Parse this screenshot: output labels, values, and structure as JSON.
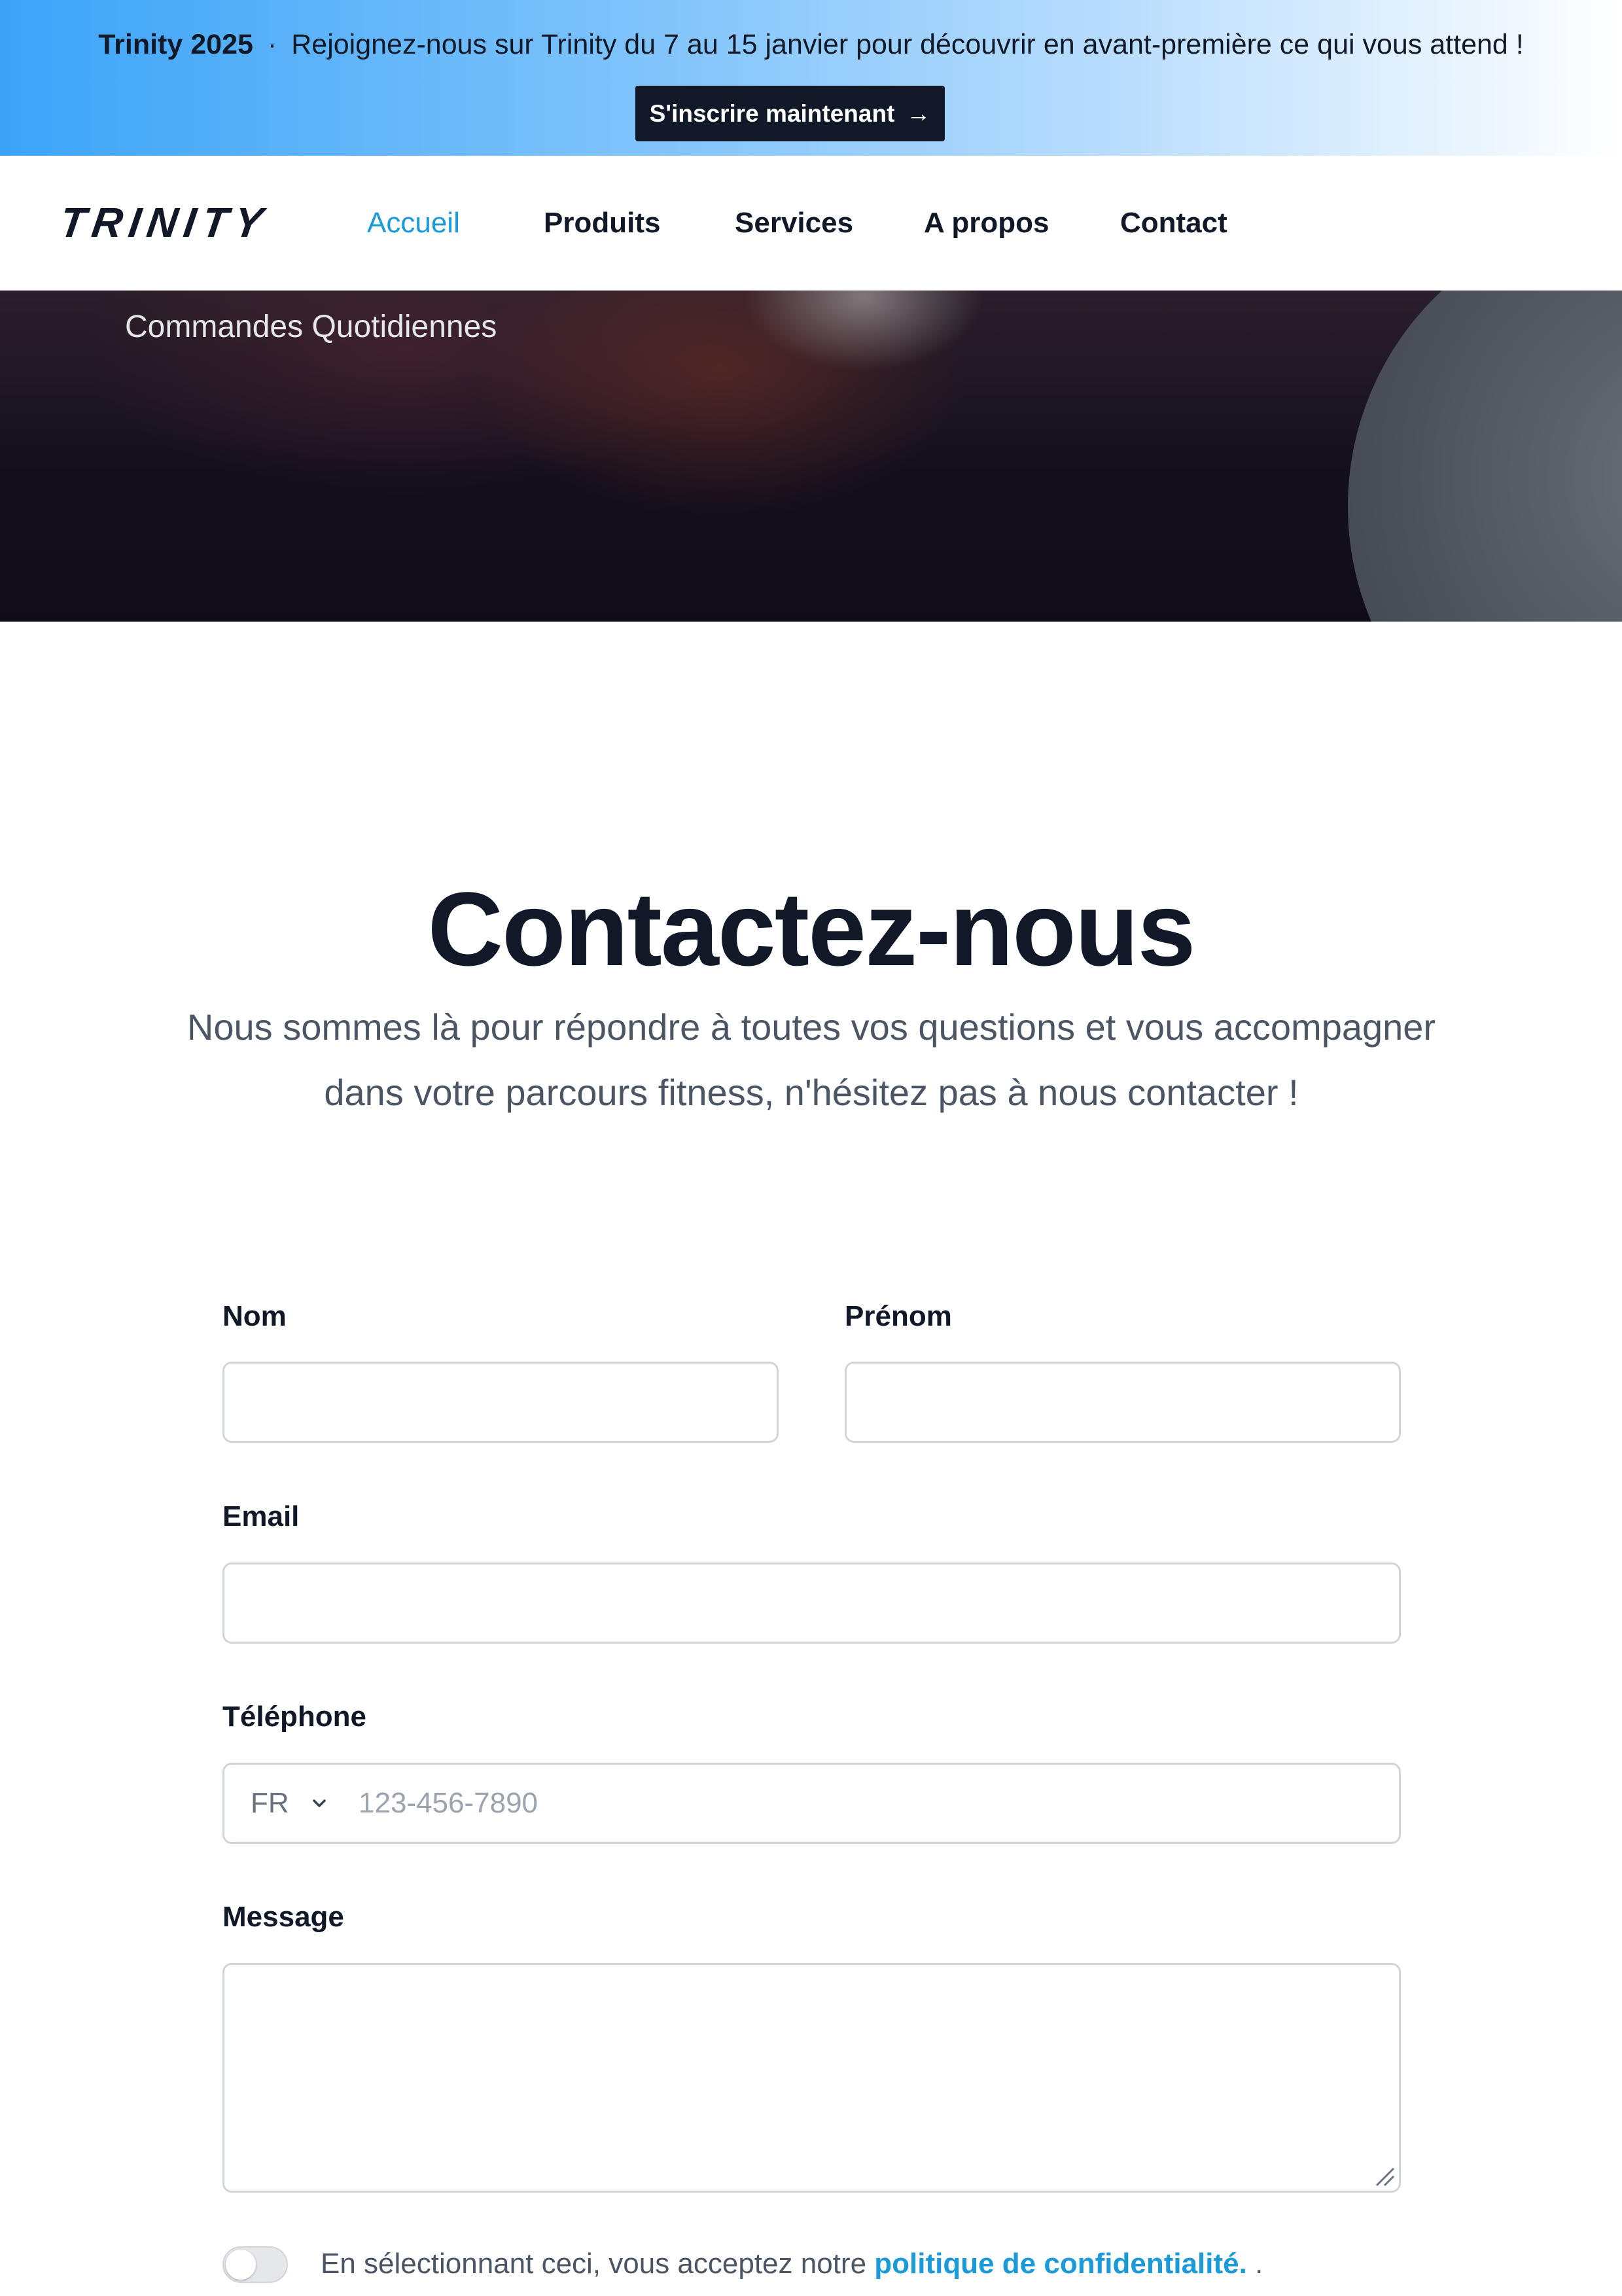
{
  "banner": {
    "brand": "Trinity 2025",
    "separator": "·",
    "message": "Rejoignez-nous sur Trinity du 7 au 15 janvier pour découvrir en avant-première ce qui vous attend !",
    "cta_label": "S'inscrire maintenant",
    "cta_arrow": "→"
  },
  "header": {
    "logo_text": "TRINITY",
    "nav": [
      {
        "label": "Accueil",
        "active": true
      },
      {
        "label": "Produits",
        "active": false
      },
      {
        "label": "Services",
        "active": false
      },
      {
        "label": "A propos",
        "active": false
      },
      {
        "label": "Contact",
        "active": false
      }
    ]
  },
  "hero": {
    "caption": "Commandes Quotidiennes"
  },
  "contact": {
    "title": "Contactez-nous",
    "subtitle": "Nous sommes là pour répondre à toutes vos questions et vous accompagner dans votre parcours fitness, n'hésitez pas à nous contacter !",
    "fields": {
      "nom": {
        "label": "Nom",
        "value": ""
      },
      "prenom": {
        "label": "Prénom",
        "value": ""
      },
      "email": {
        "label": "Email",
        "value": ""
      },
      "telephone": {
        "label": "Téléphone",
        "country": "FR",
        "placeholder": "123-456-7890",
        "value": ""
      },
      "message": {
        "label": "Message",
        "value": ""
      }
    },
    "consent": {
      "text": "En sélectionnant ceci, vous acceptez notre",
      "link_label": "politique de confidentialité.",
      "suffix": ".",
      "checked": false
    }
  },
  "colors": {
    "accent": "#1b9ad9",
    "dark": "#111827",
    "banner_start": "#3ba4f7"
  }
}
